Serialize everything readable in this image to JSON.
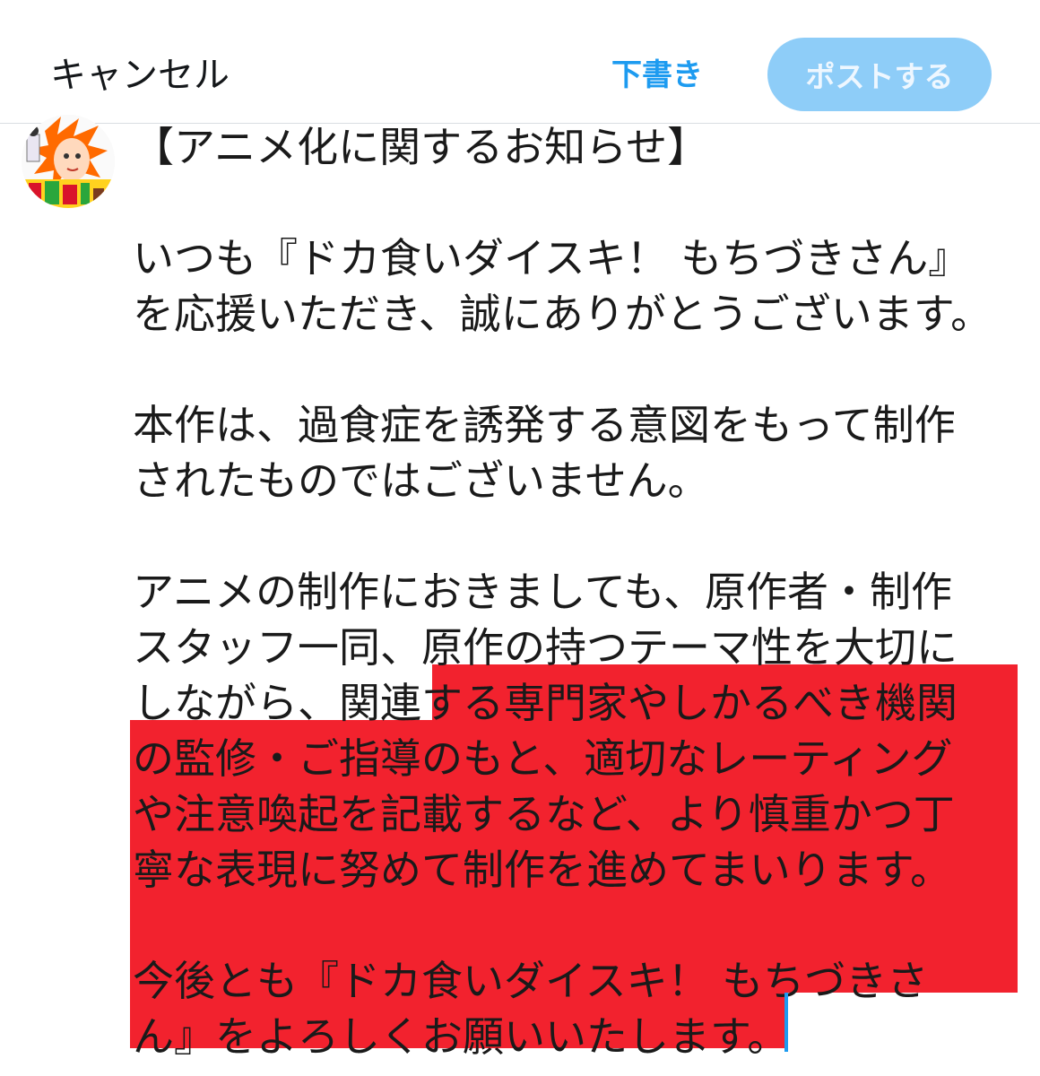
{
  "header": {
    "cancel_label": "キャンセル",
    "draft_label": "下書き",
    "post_label": "ポストする"
  },
  "composer": {
    "lines": [
      "【アニメ化に関するお知らせ】",
      "",
      "いつも『ドカ食いダイスキ！ もちづきさん』",
      "を応援いただき、誠にありがとうございます。",
      "",
      "本作は、過食症を誘発する意図をもって制作",
      "されたものではございません。",
      "",
      "アニメの制作におきましても、原作者・制作",
      "スタッフ一同、原作の持つテーマ性を大切に",
      "しながら、関連する専門家やしかるべき機関",
      "の監修・ご指導のもと、適切なレーティング",
      "や注意喚起を記載するなど、より慎重かつ丁",
      "寧な表現に努めて制作を進めてまいります。",
      "",
      "今後とも『ドカ食いダイスキ！ もちづきさ",
      "ん』をよろしくお願いいたします。"
    ]
  },
  "colors": {
    "accent": "#1d9bf0",
    "post_button_disabled": "#8ecdf8",
    "highlight": "#f2222e"
  },
  "icons": [
    "avatar-illustration"
  ]
}
